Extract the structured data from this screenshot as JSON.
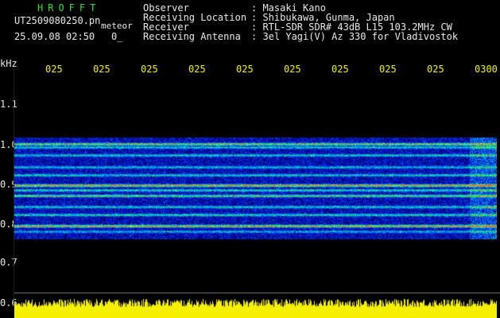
{
  "header": {
    "app_title": "HROFFT",
    "file_name": "UT2509080250.pn",
    "event_type": "meteor",
    "date_time": "25.09.08 02:50",
    "count": "0_"
  },
  "metadata": [
    {
      "label": "Observer",
      "value": ": Masaki Kano"
    },
    {
      "label": "Receiving Location",
      "value": ": Shibukawa, Gunma, Japan"
    },
    {
      "label": "Receiver",
      "value": ": RTL-SDR SDR# 43dB L15 103.2MHz CW"
    },
    {
      "label": "Receiving Antenna",
      "value": ": 3el Yagi(V) Az 330 for Vladivostok"
    }
  ],
  "axes": {
    "y_unit": "kHz",
    "y_ticks": [
      "1.1",
      "1.0",
      "0.9",
      "0.8",
      "0.7",
      "0.6"
    ],
    "x_ticks": [
      "025",
      "025",
      "025",
      "025",
      "025",
      "025",
      "025",
      "025",
      "025",
      "0300"
    ]
  },
  "colors": {
    "background": "#000000",
    "text": "#e8e8e8",
    "tick_text": "#f4f000",
    "title": "#2fe32f",
    "amplitude": "#f5f000"
  }
}
